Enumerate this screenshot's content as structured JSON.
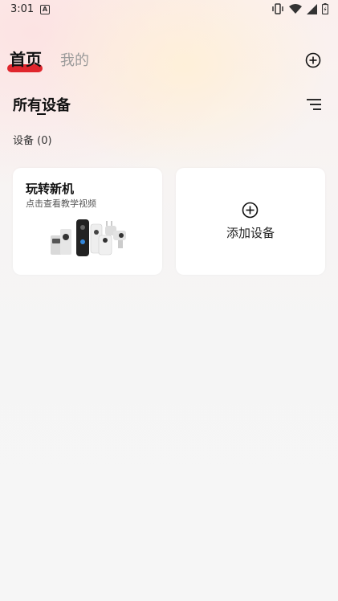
{
  "status_bar": {
    "time": "3:01",
    "app_badge": "A"
  },
  "tabs": {
    "home": "首页",
    "mine": "我的"
  },
  "header": {
    "section_title": "所有设备",
    "device_count": "设备  (0)"
  },
  "cards": {
    "tutorial": {
      "title": "玩转新机",
      "subtitle": "点击查看教学视频"
    },
    "add_device": {
      "label": "添加设备"
    }
  },
  "colors": {
    "accent": "#e0262d",
    "inactive_tab": "#9a9a9a"
  },
  "icons": [
    "vibrate-icon",
    "wifi-icon",
    "signal-icon",
    "battery-icon",
    "add-circle-icon",
    "filter-menu-icon"
  ]
}
